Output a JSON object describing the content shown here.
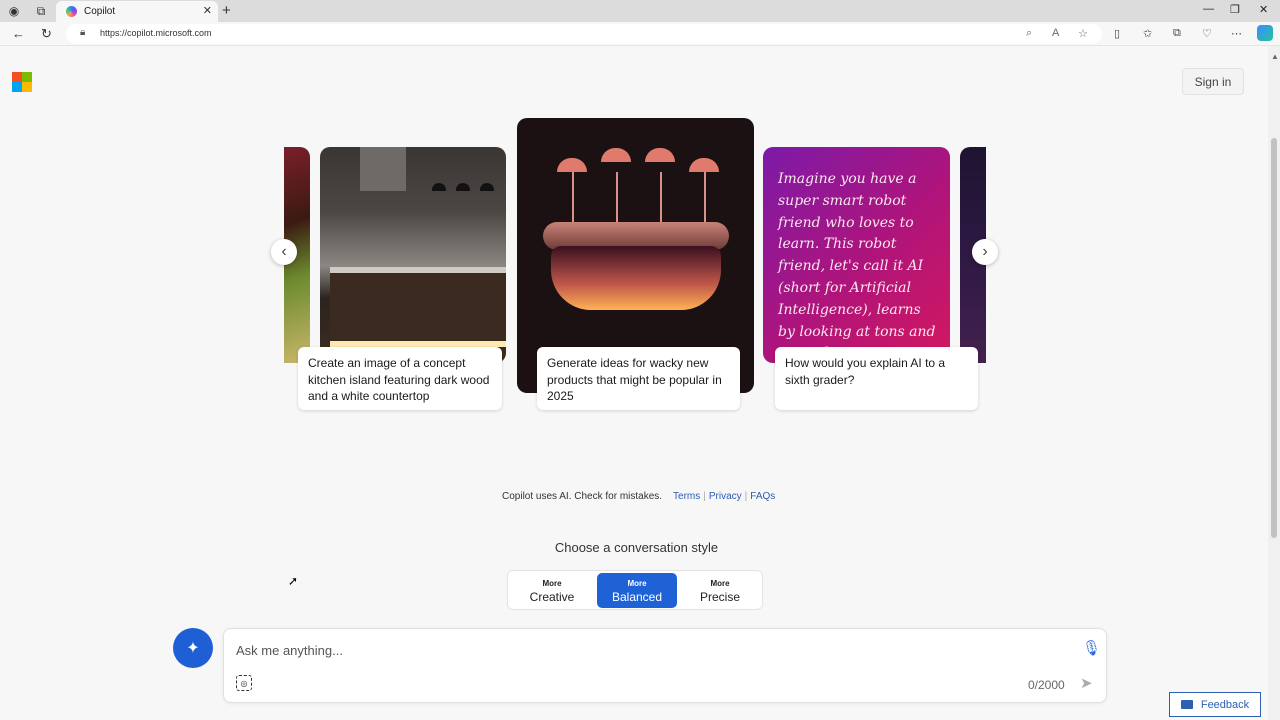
{
  "browser": {
    "tab_title": "Copilot",
    "url": "https://copilot.microsoft.com",
    "new_tab": "+",
    "close_tab": "✕"
  },
  "header": {
    "sign_in": "Sign in"
  },
  "carousel": {
    "cards": [
      {
        "caption": "Create an image of a concept kitchen island featuring dark wood and a white countertop"
      },
      {
        "caption": "Generate ideas for wacky new products that might be popular in 2025"
      },
      {
        "caption": "How would you explain AI to a sixth grader?",
        "image_text": "Imagine you have a super smart robot friend who loves to learn. This robot friend, let's call it AI (short for Artificial Intelligence), learns by looking at tons and tons of"
      }
    ]
  },
  "disclaimer": {
    "text": "Copilot uses AI. Check for mistakes.",
    "links": [
      "Terms",
      "Privacy",
      "FAQs"
    ]
  },
  "conversation_style": {
    "title": "Choose a conversation style",
    "options": [
      {
        "small": "More",
        "label": "Creative"
      },
      {
        "small": "More",
        "label": "Balanced",
        "selected": true
      },
      {
        "small": "More",
        "label": "Precise"
      }
    ],
    "accent_color": "#1f62d6"
  },
  "input": {
    "placeholder": "Ask me anything...",
    "char_count": "0/2000"
  },
  "feedback": {
    "label": "Feedback"
  }
}
